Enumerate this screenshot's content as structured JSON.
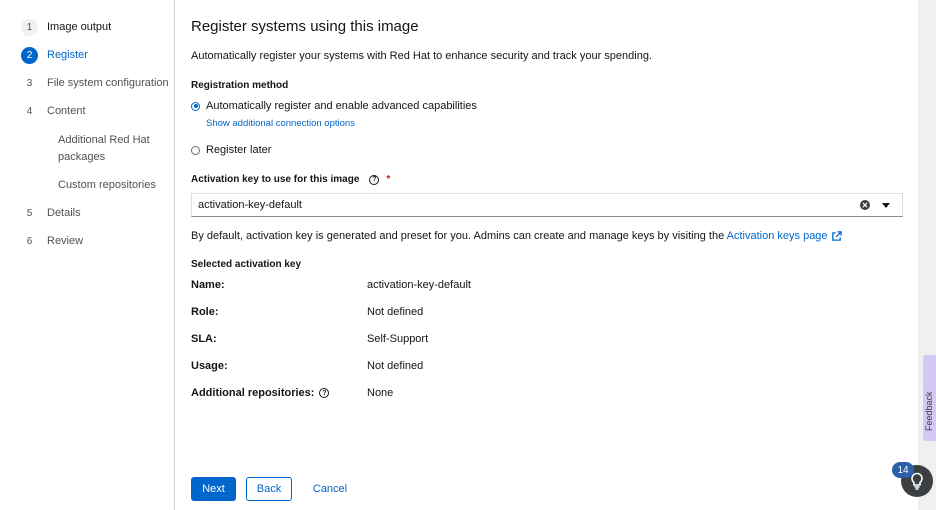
{
  "nav": {
    "steps": [
      {
        "num": "1",
        "label": "Image output"
      },
      {
        "num": "2",
        "label": "Register"
      },
      {
        "num": "3",
        "label": "File system configuration"
      },
      {
        "num": "4",
        "label": "Content"
      },
      {
        "num": "5",
        "label": "Details"
      },
      {
        "num": "6",
        "label": "Review"
      }
    ],
    "substeps": [
      "Additional Red Hat packages",
      "Custom repositories"
    ]
  },
  "main": {
    "title": "Register systems using this image",
    "description": "Automatically register your systems with Red Hat to enhance security and track your spending.",
    "registration_method_label": "Registration method",
    "radio_auto_label": "Automatically register and enable advanced capabilities",
    "show_options_link": "Show additional connection options",
    "radio_later_label": "Register later",
    "activation_key_label": "Activation key to use for this image",
    "required_mark": "*",
    "activation_key_value": "activation-key-default",
    "helper_text": "By default, activation key is generated and preset for you. Admins can create and manage keys by visiting the",
    "helper_link": "Activation keys page",
    "selected_key_heading": "Selected activation key",
    "details": [
      {
        "key": "Name:",
        "value": "activation-key-default"
      },
      {
        "key": "Role:",
        "value": "Not defined"
      },
      {
        "key": "SLA:",
        "value": "Self-Support"
      },
      {
        "key": "Usage:",
        "value": "Not defined"
      },
      {
        "key": "Additional repositories:",
        "value": "None"
      }
    ]
  },
  "footer": {
    "next_label": "Next",
    "back_label": "Back",
    "cancel_label": "Cancel"
  },
  "floaters": {
    "feedback_label": "Feedback",
    "help_badge_count": "14"
  },
  "colors": {
    "accent": "#0066cc",
    "required": "#c9190b",
    "feedback_tab": "#d3c8f6"
  }
}
